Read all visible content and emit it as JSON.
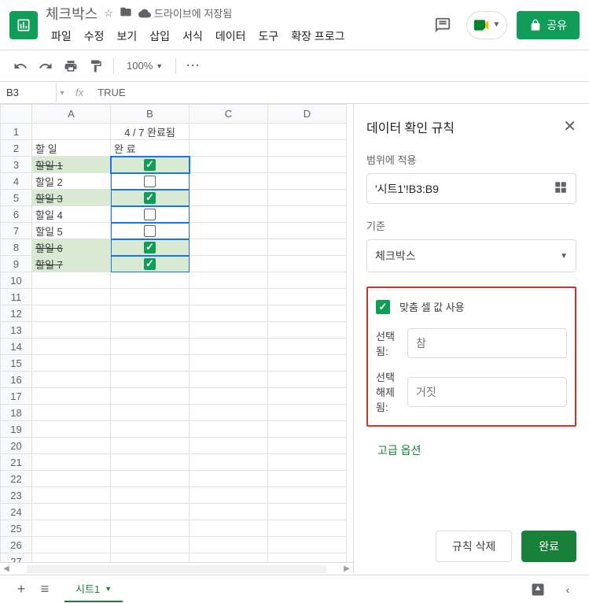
{
  "header": {
    "title": "체크박스",
    "save_status": "드라이브에 저장됨",
    "share_label": "공유",
    "menus": [
      "파일",
      "수정",
      "보기",
      "삽입",
      "서식",
      "데이터",
      "도구",
      "확장 프로그"
    ]
  },
  "toolbar": {
    "zoom": "100%"
  },
  "namebox": {
    "cell": "B3",
    "formula": "TRUE"
  },
  "sheet": {
    "columns": [
      "A",
      "B",
      "C",
      "D"
    ],
    "row_count": 28,
    "b1": "4 / 7 완료됨",
    "a2": "할 일",
    "b2": "완 료",
    "tasks": [
      {
        "label": "할일 1",
        "checked": true
      },
      {
        "label": "할일 2",
        "checked": false
      },
      {
        "label": "할일 3",
        "checked": true
      },
      {
        "label": "할일 4",
        "checked": false
      },
      {
        "label": "할일 5",
        "checked": false
      },
      {
        "label": "할일 6",
        "checked": true
      },
      {
        "label": "할일 7",
        "checked": true
      }
    ],
    "tab_name": "시트1"
  },
  "sidebar": {
    "title": "데이터 확인 규칙",
    "range_label": "범위에 적용",
    "range_value": "'시트1'!B3:B9",
    "criteria_label": "기준",
    "criteria_value": "체크박스",
    "custom_values_label": "맞춤 셀 값 사용",
    "selected_label": "선택됨:",
    "selected_placeholder": "참",
    "unselected_label": "선택 해제됨:",
    "unselected_placeholder": "거짓",
    "advanced_label": "고급 옵션",
    "delete_label": "규칙 삭제",
    "done_label": "완료"
  }
}
